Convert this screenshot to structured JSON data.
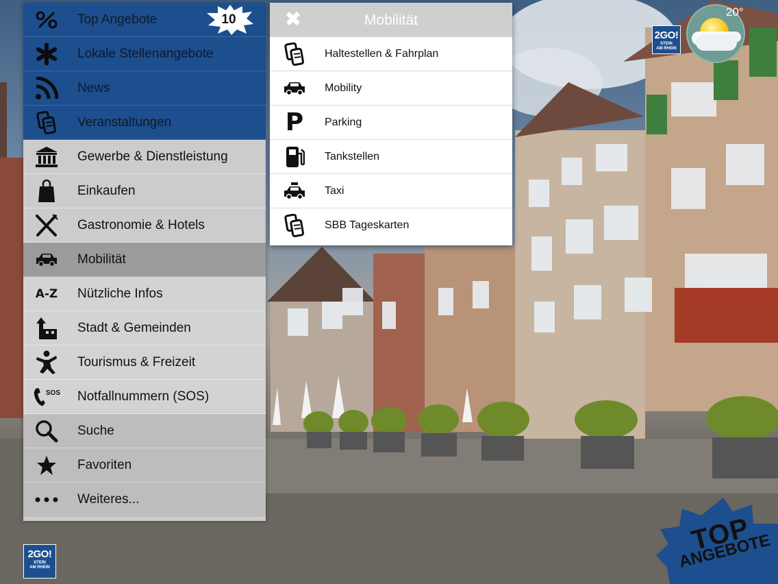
{
  "weather": {
    "temperature": "20°"
  },
  "logo": {
    "line1": "2GO!",
    "line2": "STEIN",
    "line3": "AM RHEIN"
  },
  "promo": {
    "line1": "TOP",
    "line2": "ANGEBOTE"
  },
  "menu": {
    "items": [
      {
        "label": "Top Angebote",
        "icon": "percent-icon",
        "badge": "10"
      },
      {
        "label": "Lokale Stellenangebote",
        "icon": "asterisk-icon"
      },
      {
        "label": "News",
        "icon": "rss-icon"
      },
      {
        "label": "Veranstaltungen",
        "icon": "tickets-icon"
      },
      {
        "label": "Gewerbe & Dienstleistung",
        "icon": "bank-icon"
      },
      {
        "label": "Einkaufen",
        "icon": "shopping-bag-icon"
      },
      {
        "label": "Gastronomie & Hotels",
        "icon": "fork-knife-icon"
      },
      {
        "label": "Mobilität",
        "icon": "car-icon"
      },
      {
        "label": "Nützliche Infos",
        "icon": "a-z-icon",
        "icon_text": "A-Z"
      },
      {
        "label": "Stadt & Gemeinden",
        "icon": "town-icon"
      },
      {
        "label": "Tourismus & Freizeit",
        "icon": "person-jump-icon"
      },
      {
        "label": "Notfallnummern (SOS)",
        "icon": "phone-sos-icon",
        "icon_text": "SOS"
      },
      {
        "label": "Suche",
        "icon": "search-icon"
      },
      {
        "label": "Favoriten",
        "icon": "star-icon"
      },
      {
        "label": "Weiteres...",
        "icon": "more-icon"
      }
    ]
  },
  "submenu": {
    "title": "Mobilität",
    "close": "✖",
    "items": [
      {
        "label": "Haltestellen & Fahrplan",
        "icon": "tickets-icon"
      },
      {
        "label": "Mobility",
        "icon": "car-icon"
      },
      {
        "label": "Parking",
        "icon": "parking-icon",
        "icon_text": "P"
      },
      {
        "label": "Tankstellen",
        "icon": "fuel-pump-icon"
      },
      {
        "label": "Taxi",
        "icon": "taxi-icon"
      },
      {
        "label": "SBB Tageskarten",
        "icon": "tickets-icon"
      }
    ]
  },
  "colors": {
    "menu_blue": "#1d4e8e",
    "menu_grey": "#cccccc",
    "menu_active": "#9b9b9b",
    "submenu_header": "#cfcfcf"
  }
}
